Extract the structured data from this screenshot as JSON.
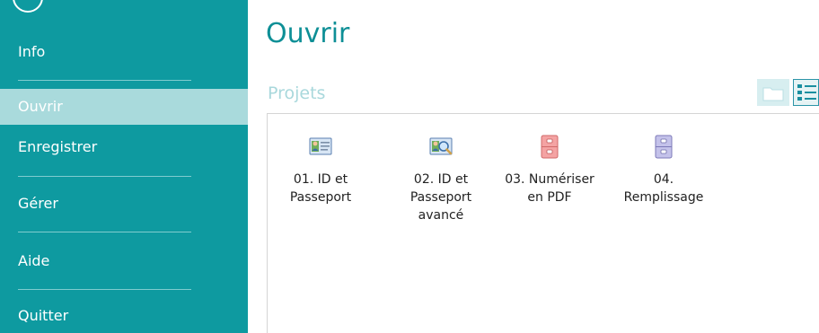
{
  "sidebar": {
    "items": [
      {
        "label": "Info",
        "active": false
      },
      {
        "label": "Ouvrir",
        "active": true
      },
      {
        "label": "Enregistrer",
        "active": false
      },
      {
        "label": "Gérer",
        "active": false
      },
      {
        "label": "Aide",
        "active": false
      },
      {
        "label": "Quitter",
        "active": false
      }
    ]
  },
  "main": {
    "title": "Ouvrir",
    "section": "Projets",
    "projects": [
      {
        "line1": "01. ID et",
        "line2": "Passeport",
        "line3": "",
        "icon": "id-card-icon"
      },
      {
        "line1": "02. ID et",
        "line2": "Passeport",
        "line3": "avancé",
        "icon": "id-card-search-icon"
      },
      {
        "line1": "03. Numériser",
        "line2": "en PDF",
        "line3": "",
        "icon": "cabinet-red-icon"
      },
      {
        "line1": "04.",
        "line2": "Remplissage",
        "line3": "",
        "icon": "cabinet-purple-icon"
      }
    ]
  },
  "colors": {
    "sidebar_bg": "#0e9aa0",
    "active_bg": "#a9dadc",
    "title": "#0e8f96",
    "section": "#a9d8dc"
  }
}
